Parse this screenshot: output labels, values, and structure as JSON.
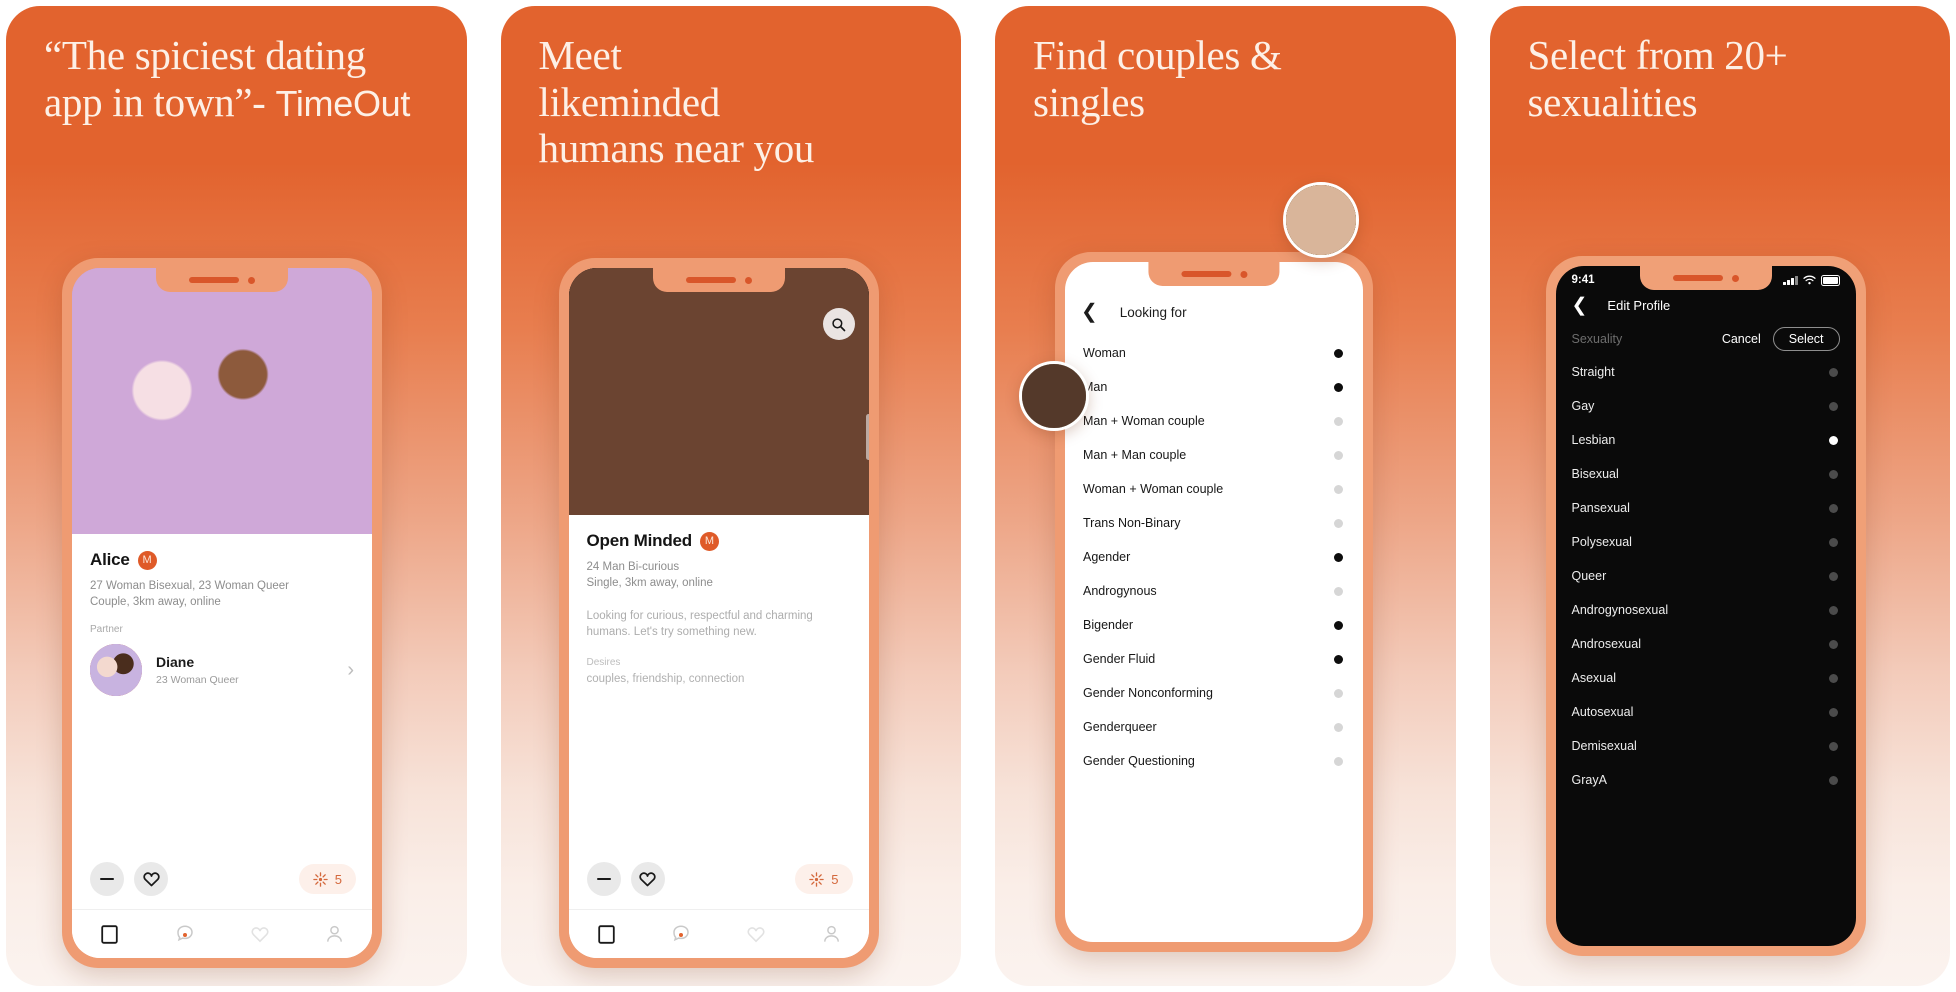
{
  "panels": [
    {
      "headline_main": "“The spiciest dating\napp in town”- ",
      "headline_attr": "TimeOut",
      "profile": {
        "name": "Alice",
        "badge": "M",
        "meta": "27 Woman Bisexual, 23 Woman Queer\nCouple, 3km away, online",
        "partner_label": "Partner",
        "partner_name": "Diane",
        "partner_meta": "23 Woman Queer",
        "chevron": "›"
      },
      "actions": {
        "pass_icon": "minus-icon",
        "like_icon": "heart-icon",
        "boost_icon": "spark-icon",
        "boost_count": "5"
      },
      "tabs": [
        "cards-icon",
        "search-icon",
        "likes-icon",
        "profile-icon"
      ],
      "active_tab": 1
    },
    {
      "headline_main": "Meet\nlikeminded\nhumans near you",
      "headline_attr": "",
      "profile": {
        "name": "Open Minded",
        "badge": "M",
        "meta": "24 Man Bi-curious\nSingle, 3km away, online",
        "bio": "Looking for curious, respectful and charming\nhumans. Let's try something new.",
        "desires_label": "Desires",
        "desires_value": "couples, friendship, connection"
      },
      "search_icon": "search-icon",
      "actions": {
        "pass_icon": "minus-icon",
        "like_icon": "heart-icon",
        "boost_icon": "spark-icon",
        "boost_count": "5"
      },
      "tabs": [
        "cards-icon",
        "search-icon",
        "likes-icon",
        "profile-icon"
      ],
      "active_tab": 1
    },
    {
      "headline_main": "Find couples &\nsingles",
      "headline_attr": "",
      "nav": {
        "back_icon": "chevron-left-icon",
        "title": "Looking for"
      },
      "options": [
        {
          "label": "Woman",
          "selected": true
        },
        {
          "label": "Man",
          "selected": true
        },
        {
          "label": "Man + Woman couple",
          "selected": false
        },
        {
          "label": "Man + Man couple",
          "selected": false
        },
        {
          "label": "Woman + Woman couple",
          "selected": false
        },
        {
          "label": "Trans Non-Binary",
          "selected": false
        },
        {
          "label": "Agender",
          "selected": true
        },
        {
          "label": "Androgynous",
          "selected": false
        },
        {
          "label": "Bigender",
          "selected": true
        },
        {
          "label": "Gender Fluid",
          "selected": true
        },
        {
          "label": "Gender Nonconforming",
          "selected": false
        },
        {
          "label": "Genderqueer",
          "selected": false
        },
        {
          "label": "Gender Questioning",
          "selected": false
        }
      ]
    },
    {
      "headline_main": "Select from 20+\nsexualities",
      "headline_attr": "",
      "statusbar": {
        "time": "9:41",
        "signal_icon": "cellular-icon",
        "wifi_icon": "wifi-icon",
        "battery_icon": "battery-icon"
      },
      "nav": {
        "back_icon": "chevron-left-icon",
        "title": "Edit Profile"
      },
      "section": {
        "label": "Sexuality",
        "cancel": "Cancel",
        "select": "Select"
      },
      "options": [
        {
          "label": "Straight",
          "selected": false
        },
        {
          "label": "Gay",
          "selected": false
        },
        {
          "label": "Lesbian",
          "selected": true
        },
        {
          "label": "Bisexual",
          "selected": false
        },
        {
          "label": "Pansexual",
          "selected": false
        },
        {
          "label": "Polysexual",
          "selected": false
        },
        {
          "label": "Queer",
          "selected": false
        },
        {
          "label": "Androgynosexual",
          "selected": false
        },
        {
          "label": "Androsexual",
          "selected": false
        },
        {
          "label": "Asexual",
          "selected": false
        },
        {
          "label": "Autosexual",
          "selected": false
        },
        {
          "label": "Demisexual",
          "selected": false
        },
        {
          "label": "GrayA",
          "selected": false
        }
      ]
    }
  ],
  "colors": {
    "brand_orange": "#e2632e",
    "phone_frame": "#ef9b72",
    "dark_screen": "#0a0a0a",
    "headline_text": "#fdf0e6"
  }
}
